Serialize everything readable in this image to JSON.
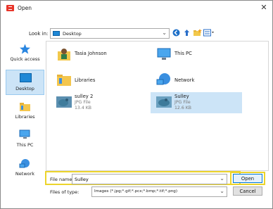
{
  "window": {
    "title": "Open"
  },
  "lookin": {
    "label": "Look in:",
    "value": "Desktop"
  },
  "places": [
    {
      "label": "Quick access",
      "icon": "star-icon"
    },
    {
      "label": "Desktop",
      "icon": "desktop-icon"
    },
    {
      "label": "Libraries",
      "icon": "libraries-icon"
    },
    {
      "label": "This PC",
      "icon": "computer-icon"
    },
    {
      "label": "Network",
      "icon": "network-icon"
    }
  ],
  "files": [
    {
      "name": "Tasia Johnson",
      "icon": "user-folder-icon",
      "selected": false
    },
    {
      "name": "This PC",
      "icon": "computer-icon",
      "selected": false
    },
    {
      "name": "Libraries",
      "icon": "libraries-icon",
      "selected": false
    },
    {
      "name": "Network",
      "icon": "network-icon",
      "selected": false
    },
    {
      "name": "sulley 2",
      "type": "JPG File",
      "size": "13.4 KB",
      "icon": "image-thumbnail",
      "selected": false
    },
    {
      "name": "Sulley",
      "type": "JPG File",
      "size": "12.6 KB",
      "icon": "image-thumbnail",
      "selected": true
    }
  ],
  "filename": {
    "label": "File name:",
    "value": "Sulley"
  },
  "filetype": {
    "label": "Files of type:",
    "value": "Images (*.jpg;*.gif;*.pcx;*.bmp;*.tif;*.png)"
  },
  "buttons": {
    "open": "Open",
    "cancel": "Cancel"
  },
  "colors": {
    "selection": "#cce4f7",
    "highlight": "#ecd42b",
    "accent": "#0078d7",
    "app_icon": "#e8352a"
  }
}
